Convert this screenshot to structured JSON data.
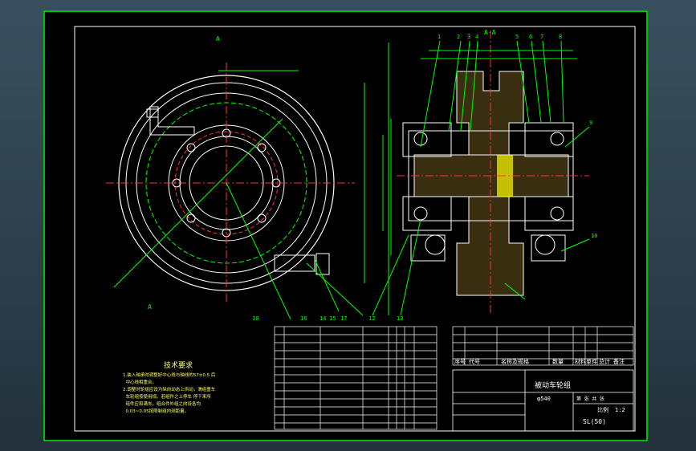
{
  "notes": {
    "title": "技术要求",
    "lines": [
      "1.装入轴承时调整好中心线与轴线的57±0.5 后",
      "  中心线相重合。",
      "2.调整时轮组应设为纵向动态上供动，滑组重车",
      "  车轮组按使用规。若组件之上停车 停下来所",
      "  组件应和满车。组合件外组之向设各均",
      "  0.03~0.05按限制组内测距量。"
    ]
  },
  "title_block": {
    "drawing_name": "被动车轮组",
    "scale_label": "比例",
    "scale_value": "1:2",
    "code": "SL(50)",
    "sheet_label": "第 张 共 张",
    "spec": "φ540"
  },
  "balloons": [
    "1",
    "2",
    "3",
    "4",
    "5",
    "6",
    "7",
    "8",
    "9",
    "10",
    "11",
    "12",
    "13",
    "14",
    "15",
    "16",
    "17",
    "18"
  ],
  "section_label": "A-A",
  "view_label": "A",
  "bom_headers": [
    "序号",
    "代号",
    "名称及规格",
    "数量",
    "材料",
    "单件",
    "总计",
    "备注"
  ]
}
